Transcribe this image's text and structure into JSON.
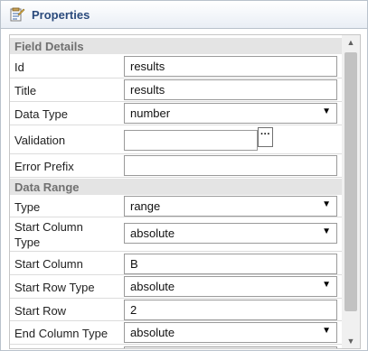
{
  "panel": {
    "title": "Properties"
  },
  "sections": {
    "field_details": "Field Details",
    "data_range": "Data Range"
  },
  "fields": {
    "id": {
      "label": "Id",
      "value": "results"
    },
    "title": {
      "label": "Title",
      "value": "results"
    },
    "data_type": {
      "label": "Data Type",
      "value": "number"
    },
    "validation": {
      "label": "Validation",
      "value": "",
      "button": "···"
    },
    "error_prefix": {
      "label": "Error Prefix",
      "value": ""
    },
    "type": {
      "label": "Type",
      "value": "range"
    },
    "start_column_type": {
      "label": "Start Column Type",
      "value": "absolute"
    },
    "start_column": {
      "label": "Start Column",
      "value": "B"
    },
    "start_row_type": {
      "label": "Start Row Type",
      "value": "absolute"
    },
    "start_row": {
      "label": "Start Row",
      "value": "2"
    },
    "end_column_type": {
      "label": "End Column Type",
      "value": "absolute"
    }
  },
  "icons": {
    "title": "properties-sheet-icon",
    "dropdown": "triangle-down",
    "scroll_up": "triangle-up",
    "scroll_down": "triangle-down"
  },
  "colors": {
    "title_text": "#2a4a7c",
    "section_bg": "#e4e4e4",
    "section_text": "#707070",
    "scroll_thumb": "#c2c2c2"
  }
}
